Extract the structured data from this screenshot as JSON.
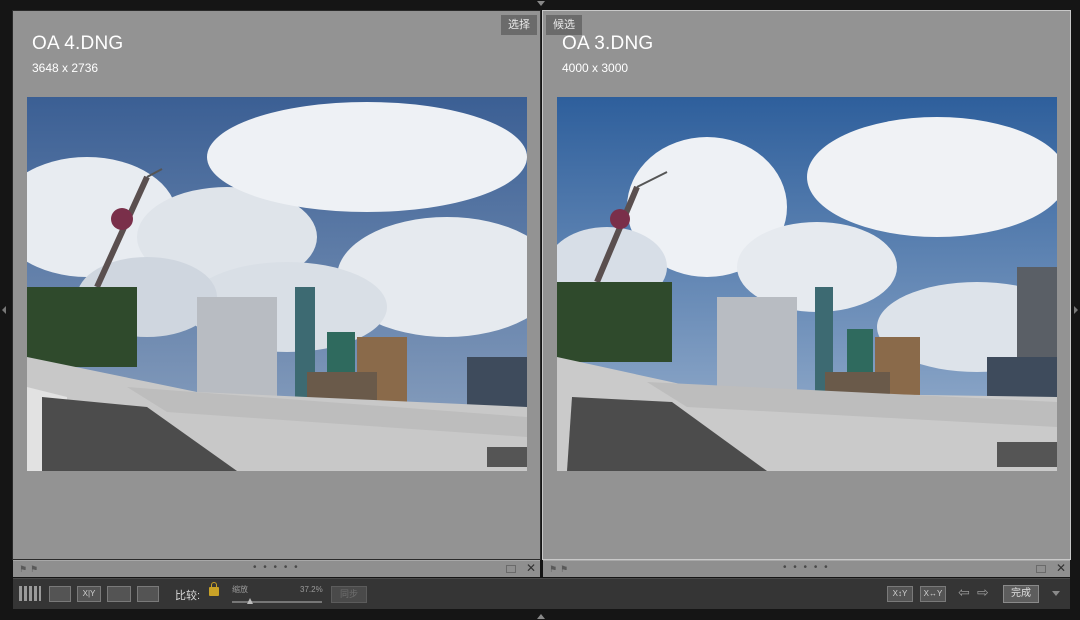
{
  "left_pane": {
    "filename": "OA 4.DNG",
    "dimensions": "3648 x 2736",
    "tag": "选择"
  },
  "right_pane": {
    "filename": "OA 3.DNG",
    "dimensions": "4000 x 3000",
    "tag": "候选"
  },
  "strip": {
    "dots": "• • • • •",
    "close_glyph": "✕"
  },
  "toolbar": {
    "xy_label": "X|Y",
    "compare_label": "比较:",
    "zoom_label": "缩放",
    "zoom_value": "37.2%",
    "sync_label": "同步",
    "swap_label": "X↕Y",
    "make_select_label": "X↔Y",
    "prev_arrow": "⇦",
    "next_arrow": "⇨",
    "done_label": "完成"
  },
  "colors": {
    "pane_bg": "#939393",
    "toolbar_bg": "#353535",
    "lock": "#c9a227"
  }
}
